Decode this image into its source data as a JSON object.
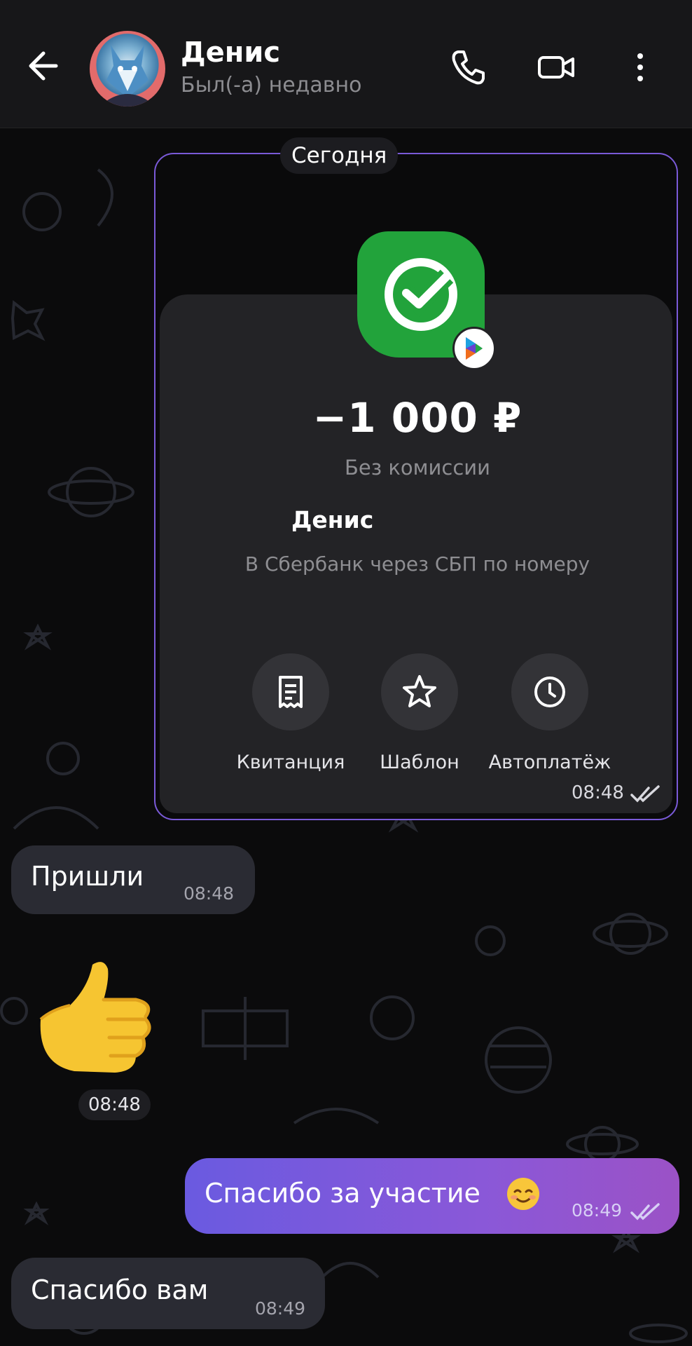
{
  "header": {
    "contact_name": "Денис",
    "contact_status": "Был(-а) недавно"
  },
  "date_divider": "Сегодня",
  "payment_card": {
    "amount": "−1 000 ₽",
    "commission": "Без комиссии",
    "recipient": "Денис",
    "transfer_via": "В Сбербанк через СБП по номеру",
    "actions": [
      "Квитанция",
      "Шаблон",
      "Автоплатёж"
    ],
    "time": "08:48",
    "brand_color": "#22a33b"
  },
  "messages": [
    {
      "direction": "in",
      "text": "Пришли",
      "time": "08:48"
    },
    {
      "direction": "in",
      "type": "sticker",
      "emoji": "👍",
      "time": "08:48"
    },
    {
      "direction": "out",
      "text": "Спасибо за участие",
      "emoji": "☺️",
      "time": "08:49",
      "status": "read"
    },
    {
      "direction": "in",
      "text": "Спасибо вам",
      "time": "08:49"
    }
  ],
  "colors": {
    "accent": "#7a5ad8",
    "outgoing_gradient_start": "#6a5ae0",
    "outgoing_gradient_end": "#9b52c6",
    "incoming_bubble": "#2a2b33"
  }
}
